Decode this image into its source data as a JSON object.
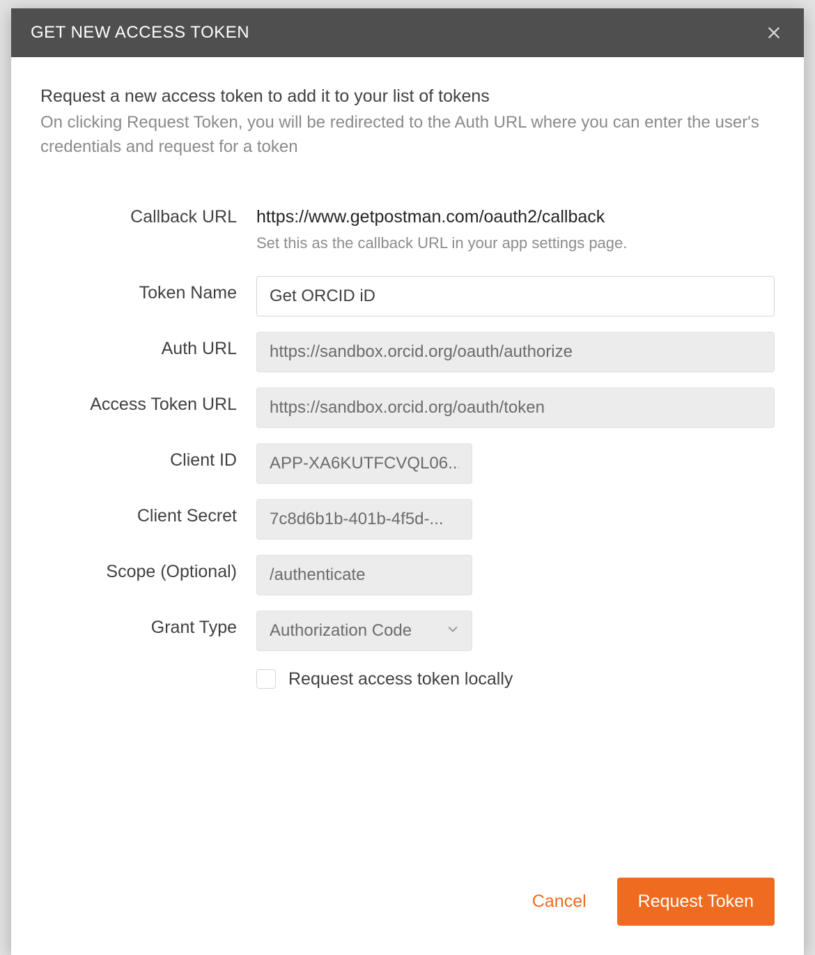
{
  "modal": {
    "title": "GET NEW ACCESS TOKEN",
    "heading": "Request a new access token to add it to your list of tokens",
    "subheading": "On clicking Request Token, you will be redirected to the Auth URL where you can enter the user's credentials and request for a token"
  },
  "fields": {
    "callback_url": {
      "label": "Callback URL",
      "value": "https://www.getpostman.com/oauth2/callback",
      "helper": "Set this as the callback URL in your app settings page."
    },
    "token_name": {
      "label": "Token Name",
      "value": "Get ORCID iD"
    },
    "auth_url": {
      "label": "Auth URL",
      "value": "https://sandbox.orcid.org/oauth/authorize"
    },
    "access_token_url": {
      "label": "Access Token URL",
      "value": "https://sandbox.orcid.org/oauth/token"
    },
    "client_id": {
      "label": "Client ID",
      "value": "APP-XA6KUTFCVQL06..."
    },
    "client_secret": {
      "label": "Client Secret",
      "value": "7c8d6b1b-401b-4f5d-..."
    },
    "scope": {
      "label": "Scope (Optional)",
      "value": "/authenticate"
    },
    "grant_type": {
      "label": "Grant Type",
      "value": "Authorization Code"
    },
    "local_request": {
      "label": "Request access token locally",
      "checked": false
    }
  },
  "buttons": {
    "cancel": "Cancel",
    "submit": "Request Token"
  }
}
